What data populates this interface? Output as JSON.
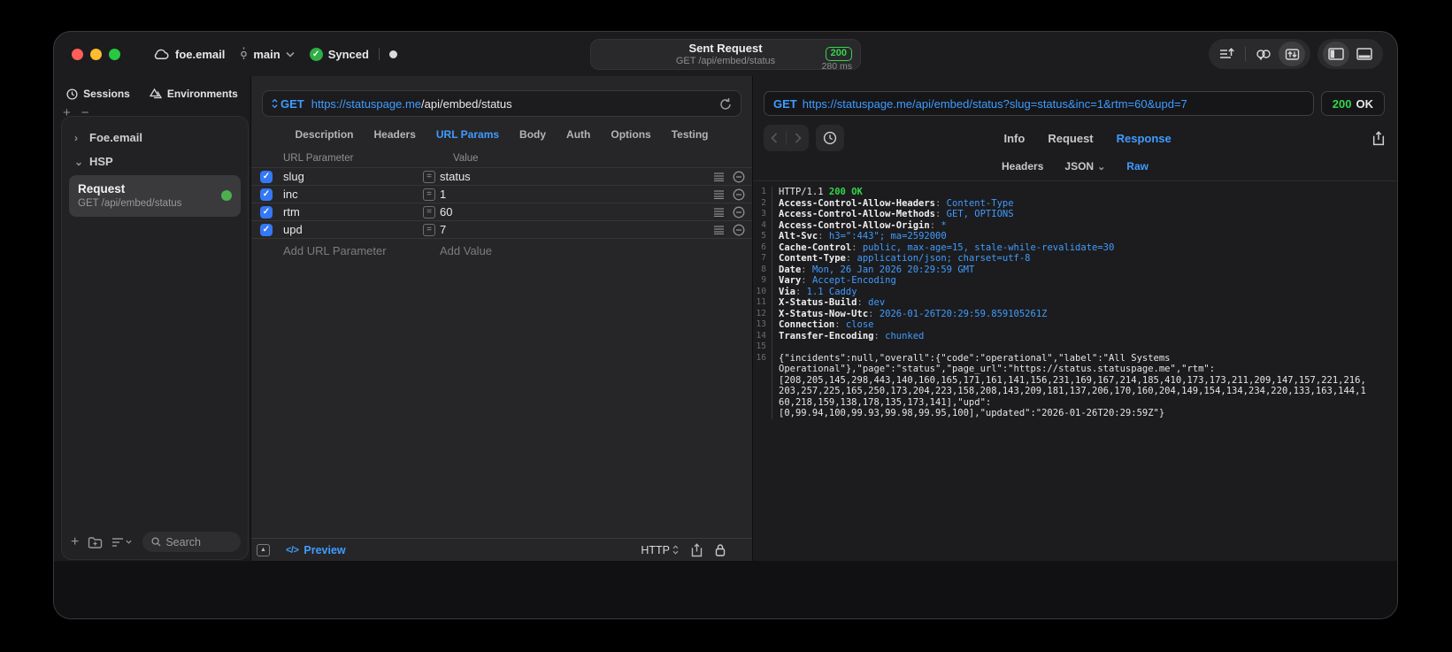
{
  "colors": {
    "accent_blue": "#3F9CFF",
    "success_green": "#32D74B",
    "checkbox_blue": "#3478F6",
    "traffic_red": "#FF5F57",
    "traffic_yellow": "#FEBC2E",
    "traffic_green": "#28C840"
  },
  "titlebar": {
    "project_name": "foe.email",
    "branch_name": "main",
    "sync_label": "Synced",
    "sent_request": {
      "title": "Sent Request",
      "subtitle": "GET /api/embed/status",
      "status_code": "200",
      "duration": "280 ms"
    }
  },
  "sidebar": {
    "tabs": [
      {
        "label": "Sessions"
      },
      {
        "label": "Environments"
      }
    ],
    "tree": [
      {
        "label": "Foe.email"
      },
      {
        "label": "HSP"
      }
    ],
    "request_item": {
      "title": "Request",
      "subtitle": "GET /api/embed/status"
    },
    "search_placeholder": "Search"
  },
  "request_editor": {
    "method": "GET",
    "url_host": "https://statuspage.me",
    "url_path": "/api/embed/status",
    "tabs": [
      "Description",
      "Headers",
      "URL Params",
      "Body",
      "Auth",
      "Options",
      "Testing"
    ],
    "active_tab": "URL Params",
    "table": {
      "col_name": "URL Parameter",
      "col_value": "Value",
      "rows": [
        {
          "enabled": true,
          "name": "slug",
          "value": "status"
        },
        {
          "enabled": true,
          "name": "inc",
          "value": "1"
        },
        {
          "enabled": true,
          "name": "rtm",
          "value": "60"
        },
        {
          "enabled": true,
          "name": "upd",
          "value": "7"
        }
      ],
      "add_name_placeholder": "Add URL Parameter",
      "add_value_placeholder": "Add Value"
    },
    "footer": {
      "preview_label": "Preview",
      "preview_icon": "</>",
      "protocol": "HTTP"
    }
  },
  "response_viewer": {
    "method": "GET",
    "url": "https://statuspage.me/api/embed/status?slug=status&inc=1&rtm=60&upd=7",
    "status_code": "200",
    "status_text": "OK",
    "tabs": [
      "Info",
      "Request",
      "Response"
    ],
    "active_tab": "Response",
    "subtabs": [
      "Headers",
      "JSON",
      "Raw"
    ],
    "active_subtab": "Raw",
    "code_lines": [
      {
        "n": "1",
        "segs": [
          [
            "HTTP/1.1 ",
            "plain"
          ],
          [
            "200 OK",
            "green"
          ]
        ]
      },
      {
        "n": "2",
        "segs": [
          [
            "Access-Control-Allow-Headers",
            "name"
          ],
          [
            ": ",
            "punct"
          ],
          [
            "Content-Type",
            "value"
          ]
        ]
      },
      {
        "n": "3",
        "segs": [
          [
            "Access-Control-Allow-Methods",
            "name"
          ],
          [
            ": ",
            "punct"
          ],
          [
            "GET, OPTIONS",
            "value"
          ]
        ]
      },
      {
        "n": "4",
        "segs": [
          [
            "Access-Control-Allow-Origin",
            "name"
          ],
          [
            ": ",
            "punct"
          ],
          [
            "*",
            "value"
          ]
        ]
      },
      {
        "n": "5",
        "segs": [
          [
            "Alt-Svc",
            "name"
          ],
          [
            ": ",
            "punct"
          ],
          [
            "h3=\":443\"; ma=2592000",
            "value"
          ]
        ]
      },
      {
        "n": "6",
        "segs": [
          [
            "Cache-Control",
            "name"
          ],
          [
            ": ",
            "punct"
          ],
          [
            "public, max-age=15, stale-while-revalidate=30",
            "value"
          ]
        ]
      },
      {
        "n": "7",
        "segs": [
          [
            "Content-Type",
            "name"
          ],
          [
            ": ",
            "punct"
          ],
          [
            "application/json; charset=utf-8",
            "value"
          ]
        ]
      },
      {
        "n": "8",
        "segs": [
          [
            "Date",
            "name"
          ],
          [
            ": ",
            "punct"
          ],
          [
            "Mon, 26 Jan 2026 20:29:59 GMT",
            "value"
          ]
        ]
      },
      {
        "n": "9",
        "segs": [
          [
            "Vary",
            "name"
          ],
          [
            ": ",
            "punct"
          ],
          [
            "Accept-Encoding",
            "value"
          ]
        ]
      },
      {
        "n": "10",
        "segs": [
          [
            "Via",
            "name"
          ],
          [
            ": ",
            "punct"
          ],
          [
            "1.1 Caddy",
            "value"
          ]
        ]
      },
      {
        "n": "11",
        "segs": [
          [
            "X-Status-Build",
            "name"
          ],
          [
            ": ",
            "punct"
          ],
          [
            "dev",
            "value"
          ]
        ]
      },
      {
        "n": "12",
        "segs": [
          [
            "X-Status-Now-Utc",
            "name"
          ],
          [
            ": ",
            "punct"
          ],
          [
            "2026-01-26T20:29:59.859105261Z",
            "value"
          ]
        ]
      },
      {
        "n": "13",
        "segs": [
          [
            "Connection",
            "name"
          ],
          [
            ": ",
            "punct"
          ],
          [
            "close",
            "value"
          ]
        ]
      },
      {
        "n": "14",
        "segs": [
          [
            "Transfer-Encoding",
            "name"
          ],
          [
            ": ",
            "punct"
          ],
          [
            "chunked",
            "value"
          ]
        ]
      },
      {
        "n": "15",
        "segs": []
      },
      {
        "n": "16",
        "segs": [
          [
            "{\"incidents\":null,\"overall\":{\"code\":\"operational\",\"label\":\"All Systems",
            "plain"
          ]
        ]
      },
      {
        "n": "",
        "segs": [
          [
            "Operational\"},\"page\":\"status\",\"page_url\":\"https://status.statuspage.me\",\"rtm\":",
            "plain"
          ]
        ]
      },
      {
        "n": "",
        "segs": [
          [
            "[208,205,145,298,443,140,160,165,171,161,141,156,231,169,167,214,185,410,173,173,211,209,147,157,221,216,",
            "plain"
          ]
        ]
      },
      {
        "n": "",
        "segs": [
          [
            "203,257,225,165,250,173,204,223,158,208,143,209,181,137,206,170,160,204,149,154,134,234,220,133,163,144,1",
            "plain"
          ]
        ]
      },
      {
        "n": "",
        "segs": [
          [
            "60,218,159,138,178,135,173,141],\"upd\":",
            "plain"
          ]
        ]
      },
      {
        "n": "",
        "segs": [
          [
            "[0,99.94,100,99.93,99.98,99.95,100],\"updated\":\"2026-01-26T20:29:59Z\"}",
            "plain"
          ]
        ]
      }
    ]
  },
  "icons": {
    "equals": "=",
    "check": "✓",
    "chevron_down": "⌄",
    "chevron_right": "›",
    "plus": "+",
    "minus": "−",
    "triangle_up": "▲"
  }
}
